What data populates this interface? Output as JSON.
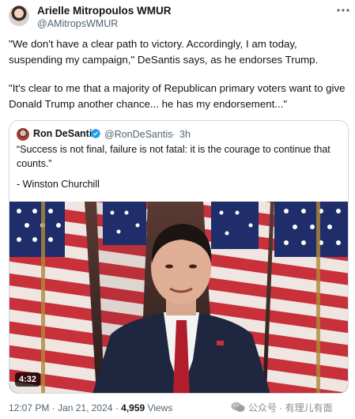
{
  "author": {
    "name": "Arielle Mitropoulos WMUR",
    "handle": "@AMitropsWMUR"
  },
  "tweet": {
    "paragraphs": [
      "\"We don't have a clear path to victory. Accordingly, I am today, suspending my campaign,\" DeSantis says, as he endorses Trump.",
      "\"It's clear to me that a majority of Republican primary voters want to give Donald Trump another chance... he has my endorsement...\""
    ]
  },
  "quoted": {
    "name": "Ron DeSantis",
    "handle": "@RonDeSantis",
    "separator": "·",
    "time": "3h",
    "text_lines": [
      "“Success is not final, failure is not fatal: it is the courage to continue that",
      "counts.”"
    ],
    "attribution": "- Winston Churchill",
    "video_duration": "4:32"
  },
  "meta": {
    "time": "12:07 PM",
    "date": "Jan 21, 2024",
    "views_count": "4,959",
    "views_label": "Views"
  },
  "watermark": {
    "text": "公众号 · 有理儿有面"
  },
  "icons": {
    "more": "more-horizontal-icon",
    "verified": "verified-badge-icon",
    "wechat": "wechat-icon"
  },
  "colors": {
    "text": "#0f1419",
    "secondary": "#536471",
    "border": "#cfd9de",
    "verified": "#1d9bf0"
  }
}
